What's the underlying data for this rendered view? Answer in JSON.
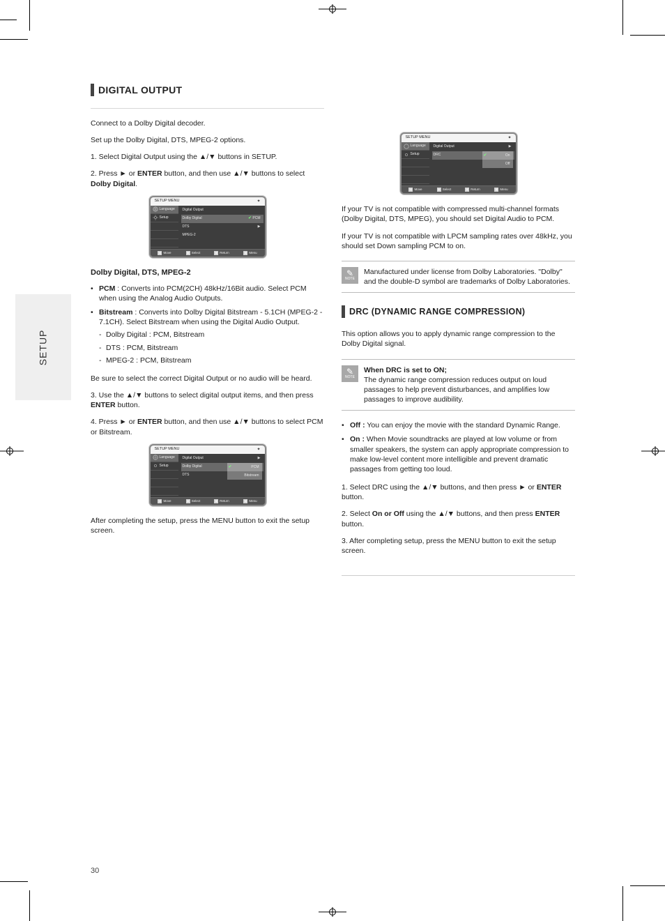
{
  "sidetab": "SETUP",
  "left": {
    "heading": "DIGITAL OUTPUT",
    "p1_a": "Connect to a Dolby Digital decoder.",
    "p1_b": "Set up the Dolby Digital, DTS, MPEG-2 options.",
    "step1": "1. Select Digital Output using the ▲/▼ buttons in SETUP.",
    "step2_pre": "2. Press ► or",
    "step2_btn": "ENTER",
    "step2_mid": "button, and then use ▲/▼ buttons to select",
    "step2_bold": "Dolby Digital",
    "section_subhead": "Dolby Digital, DTS, MPEG-2",
    "bullets": {
      "pcm": {
        "label": "PCM",
        "desc": "Converts into PCM(2CH) 48kHz/16Bit audio. Select PCM when using the Analog Audio Outputs."
      },
      "bitstream": {
        "label": "Bitstream",
        "desc": "Converts into Dolby Digital Bitstream - 5.1CH (MPEG-2 - 7.1CH). Select Bitstream when using the Digital Audio Output.",
        "sub": [
          "Dolby Digital : PCM, Bitstream",
          "DTS : PCM, Bitstream",
          "MPEG-2 : PCM, Bitstream"
        ]
      }
    },
    "be_sure": "Be sure to select the correct Digital Output or no audio will be heard.",
    "step3_pre": "3. Use the ▲/▼ buttons to select digital output items, and then",
    "step3_btn": "ENTER",
    "step3_post": "button.",
    "step4_pre": "4. Press ► or",
    "step4_btn": "ENTER",
    "step4_post": "button, and then use ▲/▼ buttons to select PCM or Bitstream.",
    "after_left": "After completing the setup, press the MENU button to exit the setup screen."
  },
  "right_top": {
    "p1_top": "If your TV is not compatible with compressed multi-channel formats (Dolby Digital, DTS, MPEG), you should set Digital Audio to PCM.",
    "p2_top": "If your TV is not compatible with LPCM sampling rates over 48kHz, you should set Down sampling PCM to on.",
    "note": "Manufactured under license from Dolby Laboratories. \"Dolby\" and the double-D symbol are trademarks of Dolby Laboratories.",
    "heading": "DRC (DYNAMIC RANGE COMPRESSION)",
    "desc": "This option allows you to apply dynamic range compression to the Dolby Digital signal.",
    "note2_lead": "When DRC is set to ON;",
    "note2_body": "The dynamic range compression reduces output on loud passages to help prevent disturbances, and amplifies low passages to improve audibility.",
    "bullets": {
      "off": {
        "label": "Off :",
        "desc": "You can enjoy the movie with the standard Dynamic Range."
      },
      "on": {
        "label": "On :",
        "desc": "When Movie soundtracks are played at low volume or from smaller speakers, the system can apply appropriate compression to make low-level content more intelligible and prevent dramatic passages from getting too loud."
      }
    },
    "steps": {
      "s1_pre": "1. Select DRC using the ▲/▼ buttons, and then press ► or",
      "s1_btn": "ENTER",
      "s1_post": "button.",
      "s2_pre": "2. Select",
      "s2_bold": "On or Off",
      "s2_mid": "using the ▲/▼ buttons, and then",
      "s2_btn": "ENTER",
      "s2_post": "button.",
      "s3": "3. After completing setup, press the MENU button to exit the setup screen."
    }
  },
  "osd": {
    "title": "SETUP MENU",
    "move_label": "Move",
    "select_label": "Select",
    "tabs": {
      "language": "Language",
      "setup": "Setup"
    },
    "leftcol_extra": [
      "",
      "",
      ""
    ],
    "screen1": {
      "menu": [
        {
          "label": "Digital Output"
        },
        {
          "label": "Dolby Digital",
          "right": "PCM",
          "selected": true
        },
        {
          "label": "DTS",
          "right": "▶"
        },
        {
          "label": "MPEG-2"
        },
        {
          "label": ""
        }
      ]
    },
    "screen2": {
      "menu": [
        {
          "label": "Digital Output",
          "right": "▶"
        },
        {
          "label": "Dolby Digital",
          "options": [
            "PCM",
            "Bitstream"
          ],
          "selectedOption": "PCM"
        },
        {
          "label": "DTS",
          "right": "▶"
        }
      ]
    },
    "screen3": {
      "menu": [
        {
          "label": "Digital Output",
          "right": "▶"
        },
        {
          "label": "DRC",
          "right": "▶",
          "options": [
            "On",
            "Off"
          ],
          "selectedOption": "On"
        }
      ]
    },
    "foot": [
      "Move",
      "Select",
      "Return",
      "Menu"
    ]
  },
  "page": "30"
}
